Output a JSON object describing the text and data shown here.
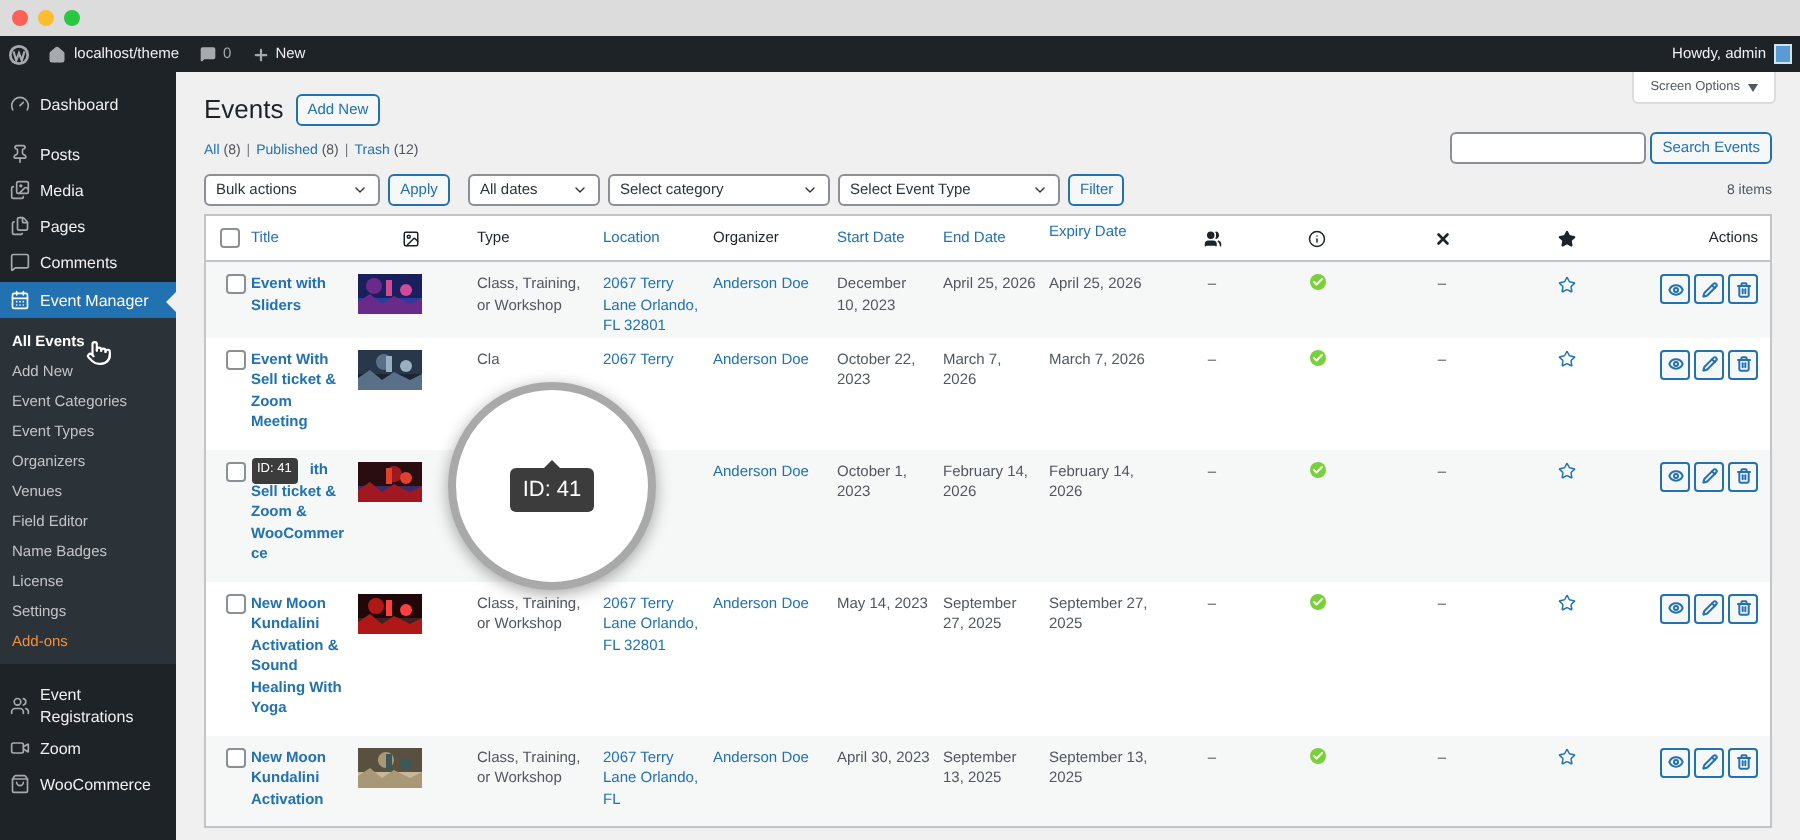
{
  "window": {
    "controls": [
      {
        "color": "#fe5f57"
      },
      {
        "color": "#febc2e"
      },
      {
        "color": "#28c840"
      }
    ]
  },
  "admin_bar": {
    "site": "localhost/theme",
    "comments": "0",
    "new": "New",
    "greeting": "Howdy, admin"
  },
  "sidebar": {
    "items": [
      {
        "label": "Dashboard",
        "selected": false
      },
      {
        "label": "Posts",
        "selected": false
      },
      {
        "label": "Media",
        "selected": false
      },
      {
        "label": "Pages",
        "selected": false
      },
      {
        "label": "Comments",
        "selected": false
      },
      {
        "label": "Event Manager",
        "selected": true,
        "children": [
          {
            "label": "All Events",
            "selected": true,
            "highlight": false
          },
          {
            "label": "Add New",
            "selected": false,
            "highlight": false
          },
          {
            "label": "Event Categories",
            "selected": false,
            "highlight": false
          },
          {
            "label": "Event Types",
            "selected": false,
            "highlight": false
          },
          {
            "label": "Organizers",
            "selected": false,
            "highlight": false
          },
          {
            "label": "Venues",
            "selected": false,
            "highlight": false
          },
          {
            "label": "Field Editor",
            "selected": false,
            "highlight": false
          },
          {
            "label": "Name Badges",
            "selected": false,
            "highlight": false
          },
          {
            "label": "License",
            "selected": false,
            "highlight": false
          },
          {
            "label": "Settings",
            "selected": false,
            "highlight": false
          },
          {
            "label": "Add-ons",
            "selected": false,
            "highlight": true
          }
        ]
      },
      {
        "label": "Event Registrations",
        "selected": false
      },
      {
        "label": "Zoom",
        "selected": false
      },
      {
        "label": "WooCommerce",
        "selected": false
      }
    ]
  },
  "page": {
    "title": "Events",
    "add_new": "Add New",
    "screen_options": "Screen Options",
    "views": [
      {
        "label": "All",
        "count": "(8)"
      },
      {
        "label": "Published",
        "count": "(8)"
      },
      {
        "label": "Trash",
        "count": "(12)"
      }
    ],
    "separator": "|",
    "search_button": "Search Events",
    "filters": {
      "bulk": "Bulk actions",
      "apply": "Apply",
      "dates": "All dates",
      "category": "Select category",
      "type": "Select Event Type",
      "filter": "Filter"
    },
    "item_count": "8 items"
  },
  "table": {
    "columns": [
      {
        "kind": "check",
        "checked": false
      },
      {
        "kind": "link",
        "label": "Title"
      },
      {
        "kind": "icon"
      },
      {
        "kind": "text",
        "label": "Type"
      },
      {
        "kind": "link",
        "label": "Location"
      },
      {
        "kind": "text",
        "label": "Organizer"
      },
      {
        "kind": "link",
        "label": "Start Date"
      },
      {
        "kind": "link",
        "label": "End Date"
      },
      {
        "kind": "link",
        "label": "Expiry Date"
      },
      {
        "kind": "icon"
      },
      {
        "kind": "icon"
      },
      {
        "kind": "icon"
      },
      {
        "kind": "icon"
      },
      {
        "kind": "text",
        "label": "Actions"
      }
    ],
    "rows": [
      {
        "checked": false,
        "title": "Event with Sliders",
        "type": "Class, Training, or Workshop",
        "location": "2067 Terry Lane Orlando, FL 32801",
        "organizer": "Anderson Doe",
        "start": "December 10, 2023",
        "end": "April 25, 2026",
        "expiry": "April 25, 2026",
        "attendees": "–",
        "approved": true,
        "cancelled": "–",
        "featured": false
      },
      {
        "checked": false,
        "title": "Event With Sell ticket & Zoom Meeting",
        "type": "Cla",
        "location": "2067 Terry",
        "organizer": "Anderson Doe",
        "start": "October 22, 2023",
        "end": "March 7, 2026",
        "expiry": "March 7, 2026",
        "attendees": "–",
        "approved": true,
        "cancelled": "–",
        "featured": false
      },
      {
        "checked": false,
        "title_fragment": "ith",
        "title": "Sell ticket & Zoom & WooCommerce",
        "organizer": "Anderson Doe",
        "start": "October 1, 2023",
        "end": "February 14, 2026",
        "expiry": "February 14, 2026",
        "attendees": "–",
        "approved": true,
        "cancelled": "–",
        "featured": false
      },
      {
        "checked": false,
        "title": "New Moon Kundalini Activation & Sound Healing With Yoga",
        "type": "Class, Training, or Workshop",
        "location": "2067 Terry Lane Orlando, FL 32801",
        "organizer": "Anderson Doe",
        "start": "May 14, 2023",
        "end": "September 27, 2025",
        "expiry": "September 27, 2025",
        "attendees": "–",
        "approved": true,
        "cancelled": "–",
        "featured": false
      },
      {
        "checked": false,
        "title": "New Moon Kundalini Activation",
        "type": "Class, Training, or Workshop",
        "location": "2067 Terry Lane Orlando, FL",
        "organizer": "Anderson Doe",
        "start": "April 30, 2023",
        "end": "September 13, 2025",
        "expiry": "September 13, 2025",
        "attendees": "–",
        "approved": true,
        "cancelled": "–",
        "featured": false
      }
    ]
  },
  "tooltip": "ID: 41",
  "magnifier": {
    "label": "ID: 41"
  }
}
